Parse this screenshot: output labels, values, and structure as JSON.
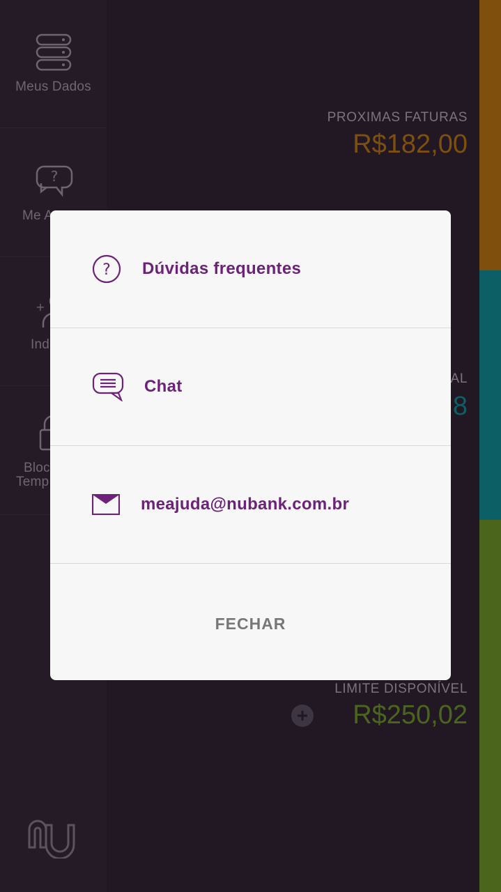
{
  "sidebar": {
    "items": [
      {
        "label": "Meus Dados",
        "icon": "database-icon"
      },
      {
        "label": "Me A",
        "icon": "chat-question-icon"
      },
      {
        "label": "Ind",
        "icon": "add-user-icon"
      },
      {
        "label": "Bloc",
        "label2": "Temp",
        "icon": "lock-icon"
      }
    ],
    "logo": "nu-logo"
  },
  "main": {
    "next_bills_label": "PROXIMAS FATURAS",
    "next_bills_amount": "R$182,00",
    "partial_label": "AL",
    "partial_amount": "8",
    "available_limit_label": "LIMITE DISPONÍVEL",
    "available_limit_amount": "R$250,02"
  },
  "colors": {
    "orange": "#7f4f0d",
    "teal": "#0d5f66",
    "green": "#4b661c",
    "purple": "#6b2278"
  },
  "dialog": {
    "options": [
      {
        "label": "Dúvidas frequentes",
        "icon": "question-circle-icon"
      },
      {
        "label": "Chat",
        "icon": "chat-bubble-icon"
      },
      {
        "label": "meajuda@nubank.com.br",
        "icon": "envelope-icon"
      }
    ],
    "close_label": "FECHAR"
  }
}
